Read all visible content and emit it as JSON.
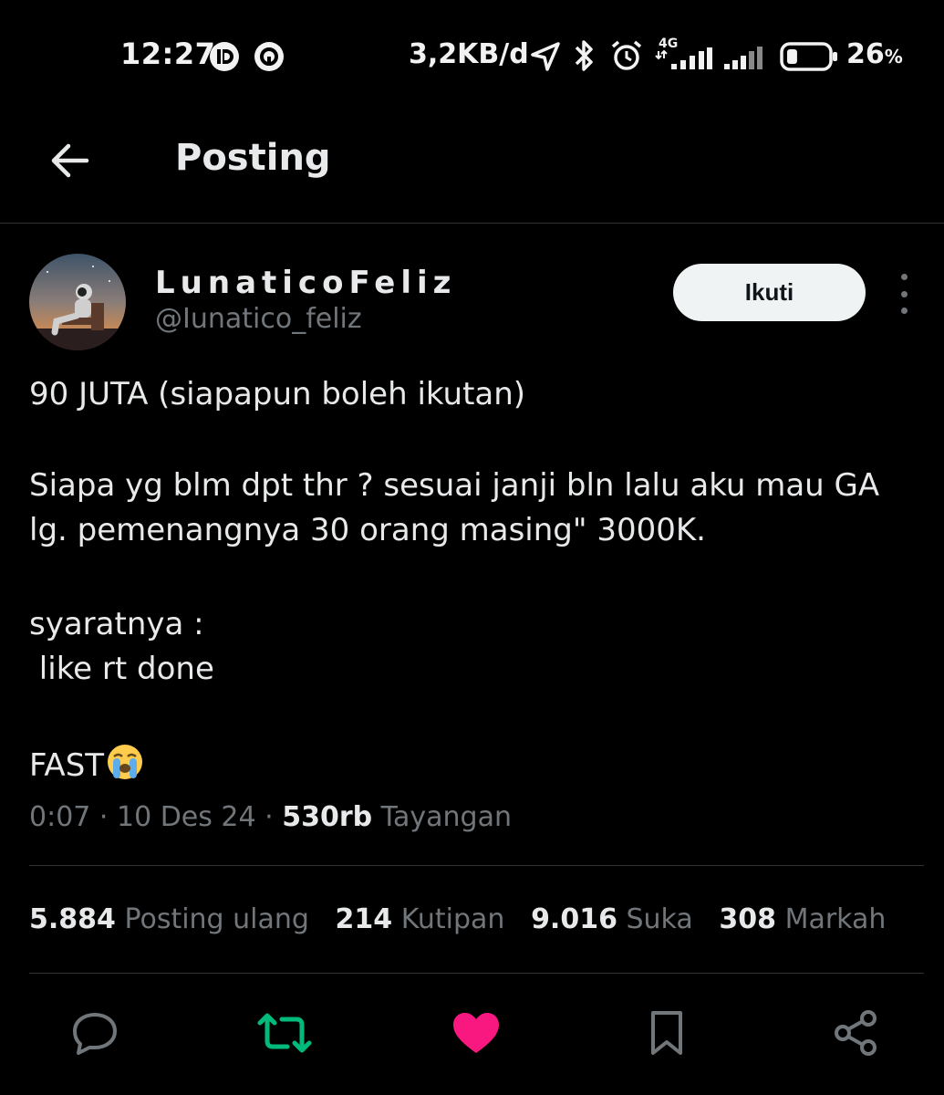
{
  "status_bar": {
    "time": "12:27",
    "net_speed": "3,2KB/d",
    "network_type": "4G",
    "battery_percent": "26",
    "battery_unit": "%",
    "battery_level": 0.26,
    "icons": [
      "d-app-icon",
      "circle-app-icon",
      "location-icon",
      "bluetooth-icon",
      "alarm-icon",
      "signal-icon",
      "signal-icon-2",
      "battery-icon"
    ]
  },
  "header": {
    "back_icon": "arrow-left-icon",
    "title": "Posting"
  },
  "author": {
    "display_name": "LunaticoFeliz",
    "handle": "@Iunatico_feliz",
    "follow_label": "Ikuti",
    "more_icon": "more-vertical-icon"
  },
  "tweet": {
    "line1": "90 JUTA (siapapun boleh ikutan)",
    "line2": "Siapa yg blm dpt thr ? sesuai janji bln lalu aku mau GA",
    "line3": "lg. pemenangnya 30 orang masing\" 3000K.",
    "line4": "syaratnya :",
    "line5": " like rt done",
    "line6": "FAST",
    "emoji": "crying-face-emoji"
  },
  "meta": {
    "time": "0:07",
    "sep": " · ",
    "date": "10 Des 24",
    "sep2": " · ",
    "views": "530rb",
    "views_label": " Tayangan"
  },
  "stats": {
    "reposts": "5.884",
    "reposts_label": " Posting ulang",
    "quotes": "214",
    "quotes_label": " Kutipan",
    "likes": "9.016",
    "likes_label": " Suka",
    "bookmarks": "308",
    "bookmarks_label": " Markah"
  },
  "actions": {
    "icons": [
      "reply-icon",
      "repost-icon",
      "like-icon",
      "bookmark-icon",
      "share-icon"
    ],
    "repost_color": "#00ba7c",
    "like_color": "#f91880",
    "icon_color": "#71767b"
  }
}
